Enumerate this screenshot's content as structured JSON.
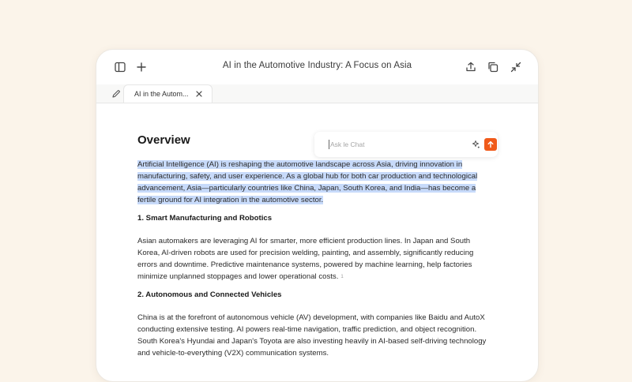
{
  "window": {
    "title": "AI in the Automotive Industry: A Focus on Asia",
    "icons": {
      "sidebar": "sidebar-toggle-icon",
      "new": "plus-icon",
      "share": "share-icon",
      "copy": "copy-icon",
      "collapse": "collapse-icon"
    }
  },
  "tabs": [
    {
      "label": "AI in the Autom...",
      "icon": "pencil-icon",
      "close_icon": "close-icon"
    }
  ],
  "document": {
    "title": "Overview",
    "intro": "Artificial Intelligence (AI) is reshaping the automotive landscape across Asia, driving innovation in manufacturing, safety, and user experience. As a global hub for both car production and technological advancement, Asia—particularly countries like China, Japan, South Korea, and India—has become a fertile ground for AI integration in the automotive sector.",
    "sections": [
      {
        "heading": "1. Smart Manufacturing and Robotics",
        "body": "Asian automakers are leveraging AI for smarter, more efficient production lines. In Japan and South Korea, AI-driven robots are used for precision welding, painting, and assembly, significantly reducing errors and downtime. Predictive maintenance systems, powered by machine learning, help factories minimize unplanned stoppages and lower operational costs.",
        "footnote": "1"
      },
      {
        "heading": "2. Autonomous and Connected Vehicles",
        "body": "China is at the forefront of autonomous vehicle (AV) development, with companies like Baidu and AutoX conducting extensive testing. AI powers real-time navigation, traffic prediction, and object recognition. South Korea's Hyundai and Japan's Toyota are also investing heavily in AI-based self-driving technology and vehicle-to-everything (V2X) communication systems."
      }
    ]
  },
  "ask_chat": {
    "placeholder": "Ask le Chat",
    "sparkle_icon": "sparkle-icon",
    "send_icon": "arrow-up-icon"
  },
  "colors": {
    "page_background": "#fbf4ea",
    "selection": "#c7dafa",
    "send_button": "#f05a1a"
  }
}
